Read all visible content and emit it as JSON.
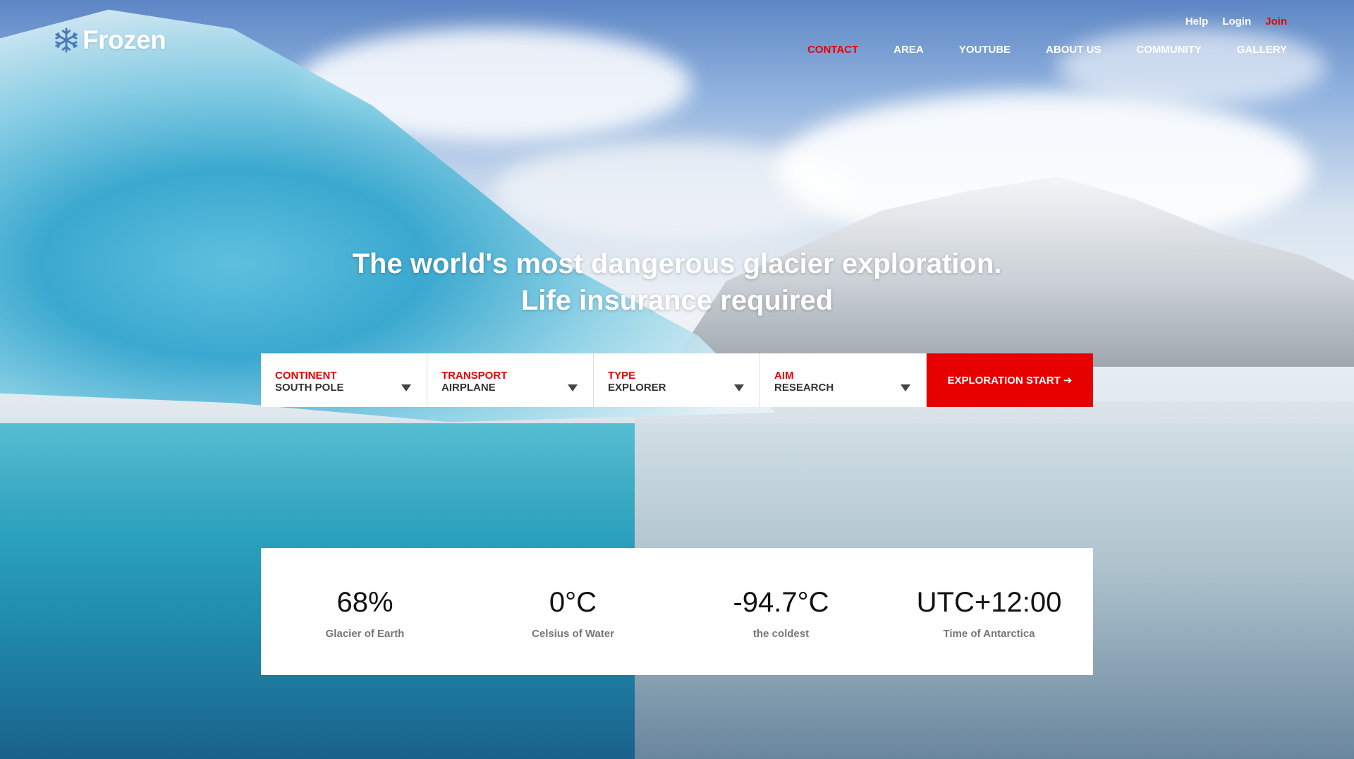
{
  "brand": {
    "name": "Frozen",
    "icon": "snowflake-icon"
  },
  "top_links": {
    "help": "Help",
    "login": "Login",
    "join": "Join"
  },
  "nav": {
    "items": [
      {
        "label": "CONTACT",
        "active": true
      },
      {
        "label": "AREA"
      },
      {
        "label": "YOUTUBE"
      },
      {
        "label": "ABOUT US"
      },
      {
        "label": "COMMUNITY"
      },
      {
        "label": "GALLERY"
      }
    ]
  },
  "headline": {
    "line1": "The world's most dangerous glacier exploration.",
    "line2": "Life insurance required"
  },
  "search": {
    "fields": [
      {
        "label": "CONTINENT",
        "value": "SOUTH POLE"
      },
      {
        "label": "TRANSPORT",
        "value": "AIRPLANE"
      },
      {
        "label": "TYPE",
        "value": "EXPLORER"
      },
      {
        "label": "AIM",
        "value": "RESEARCH"
      }
    ],
    "button": "EXPLORATION START ➔"
  },
  "stats": [
    {
      "value": "68%",
      "caption": "Glacier of Earth"
    },
    {
      "value": "0°C",
      "caption": "Celsius of Water"
    },
    {
      "value": "-94.7°C",
      "caption": "the coldest"
    },
    {
      "value": "UTC+12:00",
      "caption": "Time of Antarctica"
    }
  ],
  "colors": {
    "accent": "#e60000",
    "text_dark": "#333333",
    "caption": "#777777"
  }
}
